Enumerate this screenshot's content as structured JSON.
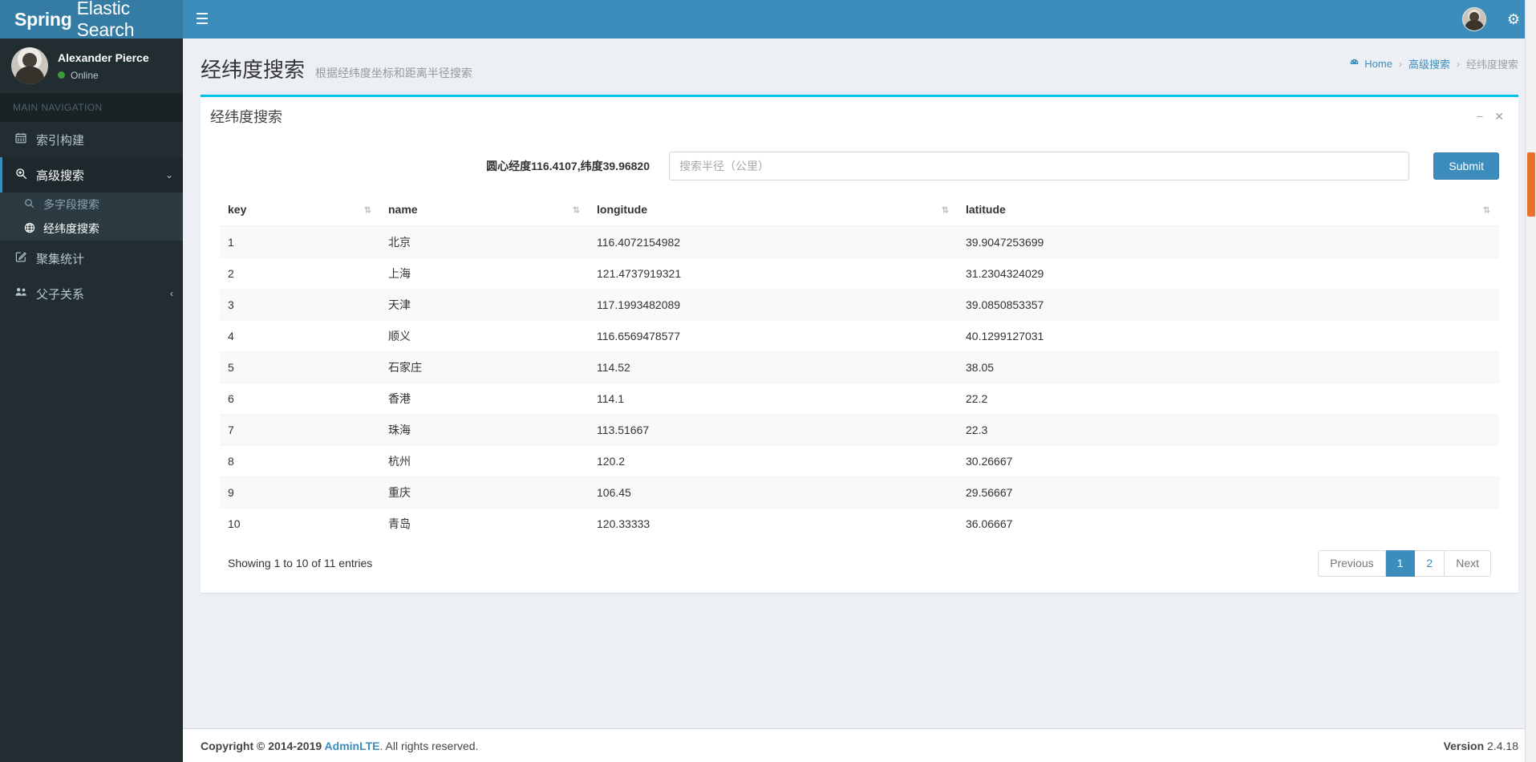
{
  "navbar": {
    "logo_bold": "Spring",
    "logo_light": "Elastic Search",
    "toggle_icon": "☰",
    "avatar_name": "user-avatar",
    "gear_icon": "⚙"
  },
  "sidebar": {
    "user": {
      "name": "Alexander Pierce",
      "status": "Online"
    },
    "section_header": "MAIN NAVIGATION",
    "items": [
      {
        "label": "索引构建",
        "icon": "Ὄ5",
        "icon_glyph": "▦",
        "active": false
      },
      {
        "label": "高级搜索",
        "icon_glyph": "⌕",
        "active": true,
        "caret": "⌄"
      },
      {
        "label": "聚集统计",
        "icon_glyph": "✎",
        "active": false
      },
      {
        "label": "父子关系",
        "icon_glyph": "♟",
        "active": false,
        "caret": "‹"
      }
    ],
    "subitems": [
      {
        "label": "多字段搜索",
        "icon_glyph": "⌕",
        "current": false
      },
      {
        "label": "经纬度搜索",
        "icon_glyph": "♁",
        "current": true
      }
    ]
  },
  "content_header": {
    "title": "经纬度搜索",
    "subtitle": "根据经纬度坐标和距离半径搜索"
  },
  "breadcrumb": {
    "home_icon": "☸",
    "home": "Home",
    "sep": "›",
    "parent": "高级搜索",
    "current": "经纬度搜索"
  },
  "box": {
    "title": "经纬度搜索",
    "minimize_icon": "−",
    "close_icon": "✕"
  },
  "search_form": {
    "center_label": "圆心经度116.4107,纬度39.96820",
    "radius_value": "",
    "radius_placeholder": "搜索半径（公里）",
    "submit_label": "Submit"
  },
  "table": {
    "columns": [
      "key",
      "name",
      "longitude",
      "latitude"
    ],
    "sort_icon": "⇅",
    "rows": [
      {
        "key": "1",
        "name": "北京",
        "longitude": "116.4072154982",
        "latitude": "39.9047253699"
      },
      {
        "key": "2",
        "name": "上海",
        "longitude": "121.4737919321",
        "latitude": "31.2304324029"
      },
      {
        "key": "3",
        "name": "天津",
        "longitude": "117.1993482089",
        "latitude": "39.0850853357"
      },
      {
        "key": "4",
        "name": "顺义",
        "longitude": "116.6569478577",
        "latitude": "40.1299127031"
      },
      {
        "key": "5",
        "name": "石家庄",
        "longitude": "114.52",
        "latitude": "38.05"
      },
      {
        "key": "6",
        "name": "香港",
        "longitude": "114.1",
        "latitude": "22.2"
      },
      {
        "key": "7",
        "name": "珠海",
        "longitude": "113.51667",
        "latitude": "22.3"
      },
      {
        "key": "8",
        "name": "杭州",
        "longitude": "120.2",
        "latitude": "30.26667"
      },
      {
        "key": "9",
        "name": "重庆",
        "longitude": "106.45",
        "latitude": "29.56667"
      },
      {
        "key": "10",
        "name": "青岛",
        "longitude": "120.33333",
        "latitude": "36.06667"
      }
    ],
    "info": "Showing 1 to 10 of 11 entries",
    "pager": {
      "previous": "Previous",
      "pages": [
        "1",
        "2"
      ],
      "active_page": "1",
      "next": "Next"
    }
  },
  "footer": {
    "copyright_prefix": "Copyright © 2014-2019 ",
    "brand": "AdminLTE",
    "copyright_suffix": ". All rights reserved.",
    "version_label": "Version",
    "version_number": " 2.4.18"
  },
  "colors": {
    "brand_blue": "#3c8dbc",
    "logo_blue": "#357ca5",
    "sidebar_dark": "#222d32",
    "box_accent": "#00c0ef",
    "content_bg": "#ecf0f5",
    "online_green": "#3c9c3c",
    "scrollbar_thumb": "#e8722a"
  }
}
